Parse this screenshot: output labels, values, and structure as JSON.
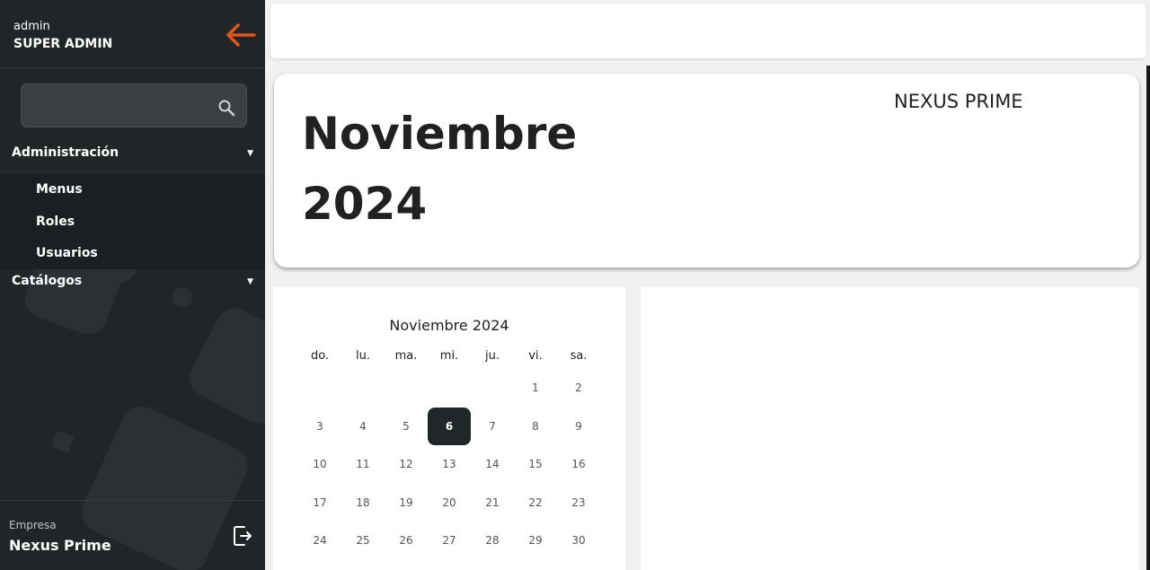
{
  "sidebar": {
    "user": "admin",
    "role": "SUPER ADMIN",
    "search_value": "",
    "sections": [
      {
        "label": "Administración",
        "items": [
          "Menus",
          "Roles",
          "Usuarios"
        ]
      },
      {
        "label": "Catálogos",
        "items": []
      }
    ],
    "footer": {
      "company_label": "Empresa",
      "company_name": "Nexus Prime"
    }
  },
  "hero": {
    "month": "Noviembre",
    "year": "2024",
    "brand": "NEXUS PRIME"
  },
  "calendar": {
    "title": "Noviembre 2024",
    "weekdays": [
      "do.",
      "lu.",
      "ma.",
      "mi.",
      "ju.",
      "vi.",
      "sa."
    ],
    "first_weekday_index": 5,
    "days_shown": 30,
    "selected_day": 6
  },
  "colors": {
    "sidebar_bg": "#202628",
    "accent_arrow": "#e2541b",
    "selected_day_bg": "#212628"
  },
  "icons": {
    "back": "arrow-left-icon",
    "search": "search-icon",
    "caret": "caret-down-icon",
    "logout": "logout-icon"
  }
}
